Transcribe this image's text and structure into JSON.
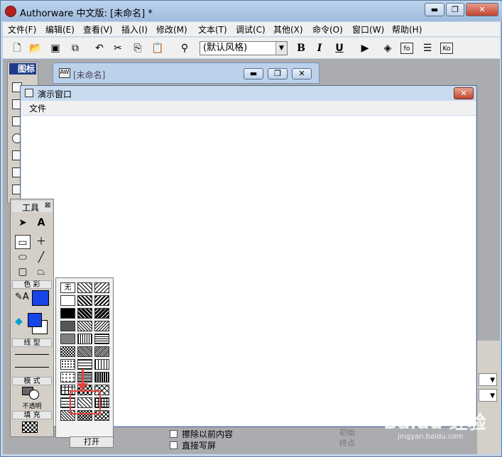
{
  "window": {
    "title": "Authorware 中文版: [未命名] *",
    "minimize": "▬",
    "restore": "❐",
    "close": "✕"
  },
  "menubar": [
    "文件(F)",
    "编辑(E)",
    "查看(V)",
    "插入(I)",
    "修改(M)",
    "文本(T)",
    "调试(C)",
    "其他(X)",
    "命令(O)",
    "窗口(W)",
    "帮助(H)"
  ],
  "toolbar": {
    "style_select": "(默认风格)",
    "bold": "B",
    "italic": "I",
    "underline": "U"
  },
  "icon_palette": {
    "title": "图标"
  },
  "flowline_window": {
    "title": "[未命名]"
  },
  "presentation": {
    "title": "演示窗口",
    "menu_file": "文件"
  },
  "tools": {
    "title": "工具",
    "color_label": "色 彩",
    "line_label": "线 型",
    "mode_label": "模 式",
    "mode_value": "不透明",
    "fill_label": "填 充",
    "text_tool": "A"
  },
  "patterns": {
    "none": "无"
  },
  "bottom_options": {
    "erase_previous": "擦除以前内容",
    "direct_to_screen": "直接写屏",
    "open_button": "打开",
    "radio_initial": "初始",
    "radio_end": "终点"
  },
  "watermark": {
    "text": "Baidu 经验",
    "sub": "jingyan.baidu.com"
  },
  "colors": {
    "stroke_color": "#1744e8",
    "fill_fg": "#1744e8",
    "highlight": "#e4423b",
    "title_gradient": "#bcd3ee"
  }
}
